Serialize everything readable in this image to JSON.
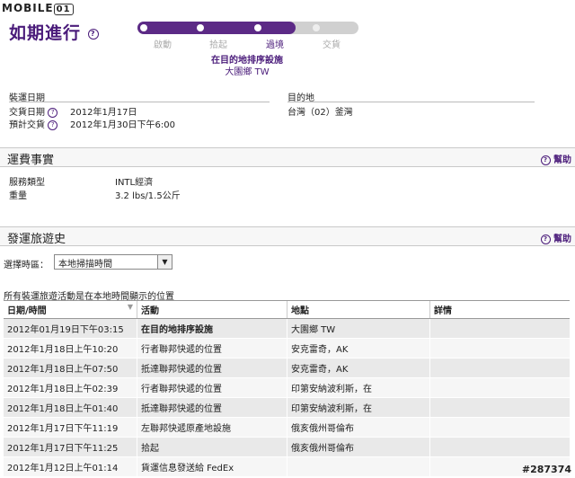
{
  "logo": {
    "brand": "MOBILE",
    "box": "01"
  },
  "page": {
    "title": "如期進行"
  },
  "progress": {
    "steps": [
      "啟動",
      "拾起",
      "過境",
      "交貨"
    ],
    "current_step": 3,
    "status_line1": "在目的地排序設施",
    "status_line2": "大園鄉 TW"
  },
  "shipment": {
    "ship_date_label": "裝運日期",
    "delivery_date_label": "交貨日期",
    "delivery_date_value": "2012年1月17日",
    "est_delivery_label": "預計交貨",
    "est_delivery_value": "2012年1月30日下午6:00",
    "destination_label": "目的地",
    "destination_value": "台灣（02）釜灣"
  },
  "fees": {
    "section_title": "運費事實",
    "help": "幫助",
    "service_type_label": "服務類型",
    "service_type_value": "INTL經濟",
    "weight_label": "重量",
    "weight_value": "3.2 lbs/1.5公斤"
  },
  "history": {
    "section_title": "發運旅遊史",
    "help": "幫助",
    "timezone_label": "選擇時區：",
    "timezone_value": "本地掃描時間",
    "note": "所有裝運旅遊活動是在本地時間顯示的位置",
    "columns": [
      "日期/時間",
      "活動",
      "地點",
      "詳情"
    ],
    "rows": [
      [
        "2012年01月19日下午03:15",
        "在目的地排序設施",
        "大園鄉 TW",
        ""
      ],
      [
        "2012年1月18日上午10:20",
        "行者聯邦快遞的位置",
        "安克雷奇，AK",
        ""
      ],
      [
        "2012年1月18日上午07:50",
        "抵達聯邦快遞的位置",
        "安克雷奇，AK",
        ""
      ],
      [
        "2012年1月18日上午02:39",
        "行者聯邦快遞的位置",
        "印第安納波利斯，在",
        ""
      ],
      [
        "2012年1月18日上午01:40",
        "抵達聯邦快遞的位置",
        "印第安納波利斯，在",
        ""
      ],
      [
        "2012年1月17日下午11:19",
        "左聯邦快遞原產地設施",
        "俄亥俄州哥倫布",
        ""
      ],
      [
        "2012年1月17日下午11:25",
        "拾起",
        "俄亥俄州哥倫布",
        ""
      ],
      [
        "2012年1月12日上午01:14",
        "貨運信息發送給 FedEx",
        "",
        ""
      ]
    ]
  },
  "watermark": "#287374"
}
